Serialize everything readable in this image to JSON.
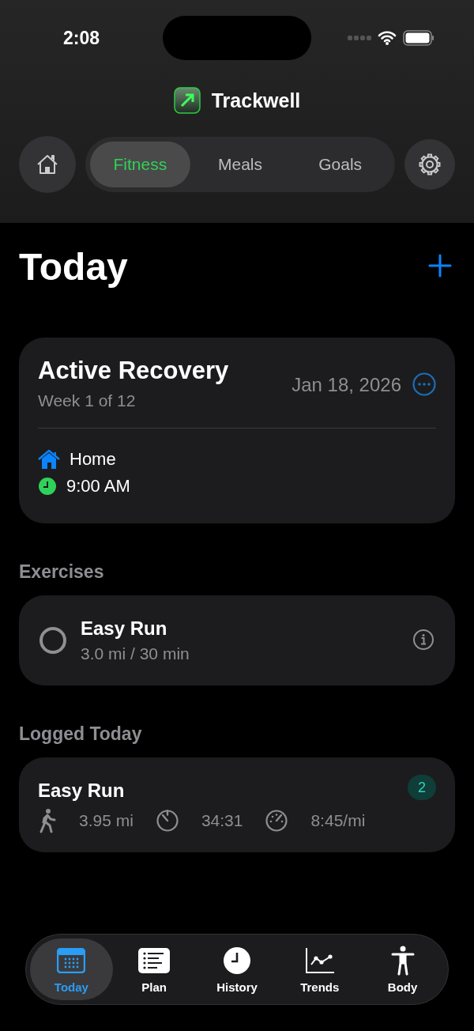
{
  "status_bar": {
    "time": "2:08"
  },
  "app": {
    "name": "Trackwell"
  },
  "segments": [
    {
      "label": "Fitness",
      "selected": true
    },
    {
      "label": "Meals",
      "selected": false
    },
    {
      "label": "Goals",
      "selected": false
    }
  ],
  "page_title": "Today",
  "workout": {
    "title": "Active Recovery",
    "subtitle": "Week 1 of 12",
    "date": "Jan 18, 2026",
    "location": "Home",
    "time": "9:00 AM"
  },
  "exercises": {
    "heading": "Exercises",
    "items": [
      {
        "name": "Easy Run",
        "detail": "3.0 mi / 30 min",
        "checked": false
      }
    ]
  },
  "logged": {
    "heading": "Logged Today",
    "items": [
      {
        "name": "Easy Run",
        "badge": "2",
        "stats": [
          "3.95 mi",
          "34:31",
          "8:45/mi"
        ]
      }
    ]
  },
  "tab_bar": [
    {
      "label": "Today",
      "selected": true
    },
    {
      "label": "Plan",
      "selected": false
    },
    {
      "label": "History",
      "selected": false
    },
    {
      "label": "Trends",
      "selected": false
    },
    {
      "label": "Body",
      "selected": false
    }
  ]
}
